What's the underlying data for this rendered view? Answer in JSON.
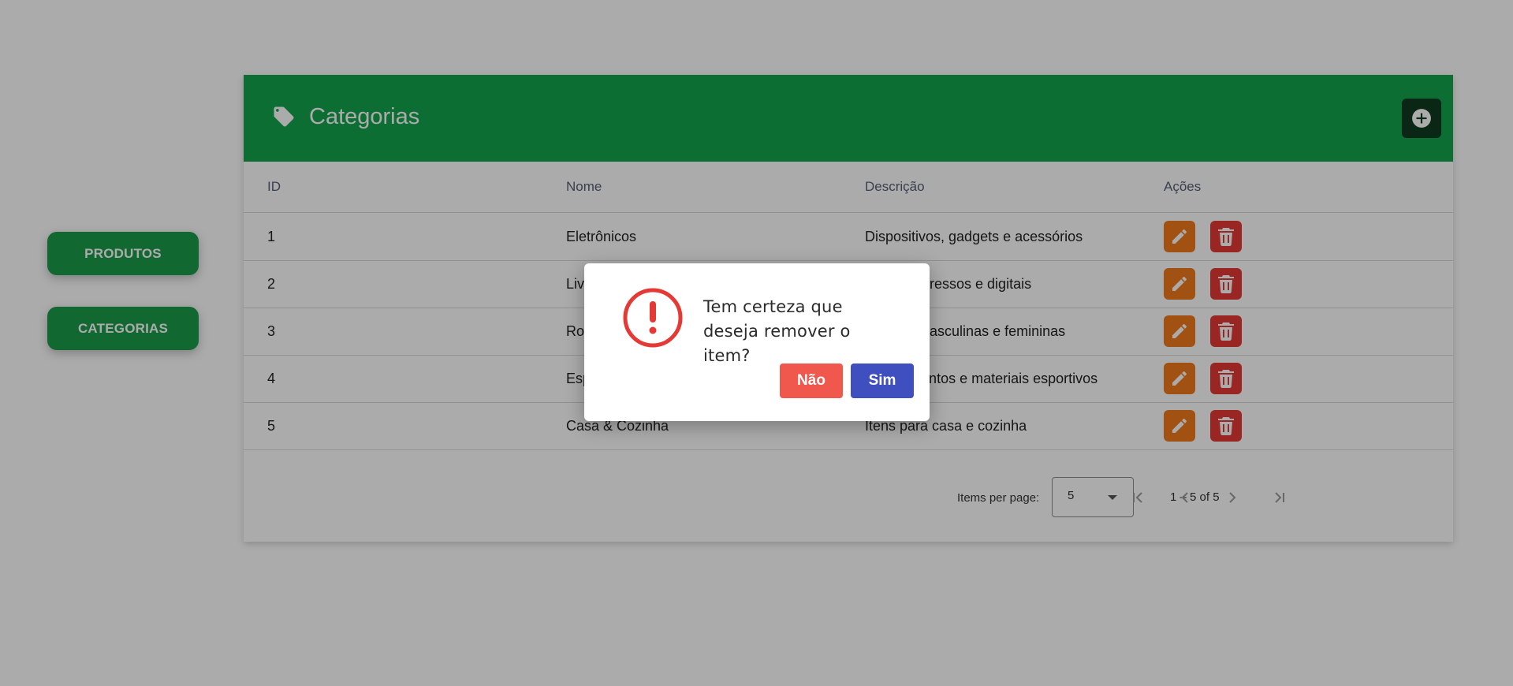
{
  "nav": {
    "produtos": "PRODUTOS",
    "categorias": "CATEGORIAS"
  },
  "card": {
    "title": "Categorias",
    "header_color": "#14a44d",
    "icons": {
      "title": "tag-icon",
      "add": "plus-circle-icon"
    }
  },
  "table": {
    "columns": [
      "ID",
      "Nome",
      "Descrição",
      "Ações"
    ],
    "rows": [
      {
        "id": "1",
        "nome": "Eletrônicos",
        "descricao": "Dispositivos, gadgets e acessórios"
      },
      {
        "id": "2",
        "nome": "Livros",
        "descricao": "Livros impressos e digitais"
      },
      {
        "id": "3",
        "nome": "Roupas",
        "descricao": "Roupas masculinas e femininas"
      },
      {
        "id": "4",
        "nome": "Esportes",
        "descricao": "Equipamentos e materiais esportivos"
      },
      {
        "id": "5",
        "nome": "Casa & Cozinha",
        "descricao": "Itens para casa e cozinha"
      }
    ],
    "action_icons": [
      "pencil-icon",
      "trash-icon"
    ]
  },
  "paginator": {
    "label": "Items per page:",
    "page_size": "5",
    "range": "1 – 5 of 5",
    "icons": [
      "first-page-icon",
      "prev-page-icon",
      "next-page-icon",
      "last-page-icon"
    ]
  },
  "dialog": {
    "message": "Tem certeza que deseja remover o item?",
    "no": "Não",
    "yes": "Sim",
    "icon": "exclamation-circle-icon",
    "colors": {
      "no": "#f1584d",
      "yes": "#3f4fbf",
      "icon": "#e53935"
    }
  }
}
